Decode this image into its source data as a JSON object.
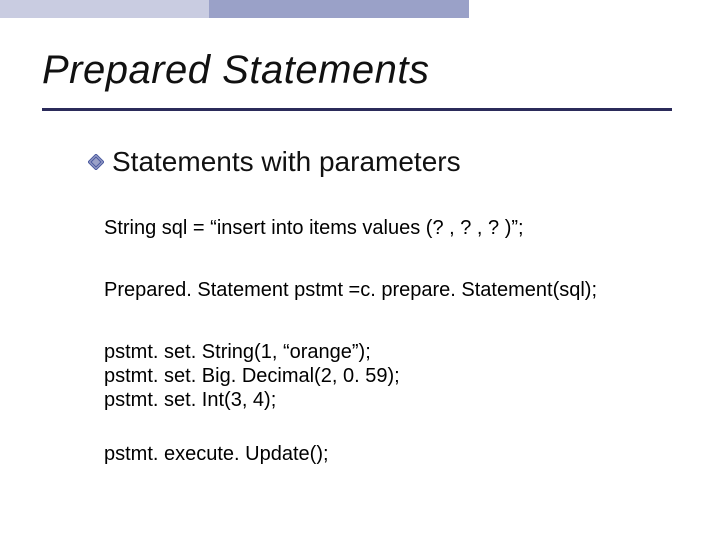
{
  "header": {
    "title": "Prepared Statements"
  },
  "bullets": [
    {
      "label": "Statements with parameters"
    }
  ],
  "code": {
    "line1": "String sql = “insert into items values (? , ? , ? )”;",
    "line2": "Prepared. Statement pstmt =c. prepare. Statement(sql);",
    "block3": {
      "l1": "pstmt. set. String(1, “orange”);",
      "l2": "pstmt. set. Big. Decimal(2, 0. 59);",
      "l3": "pstmt. set. Int(3, 4);"
    },
    "line4": "pstmt. execute. Update();"
  },
  "colors": {
    "top_a": "#c9cce1",
    "top_b": "#9aa1c8",
    "underline": "#2b2b5a",
    "bullet_fill": "#9aa1c8",
    "bullet_stroke": "#4b5aa0"
  }
}
